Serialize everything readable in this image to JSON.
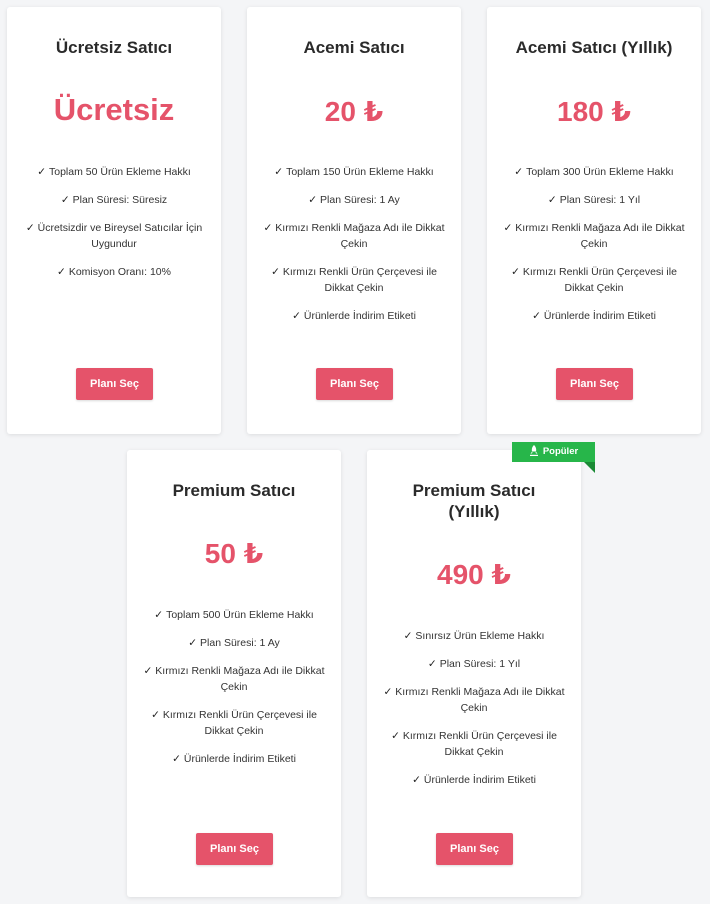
{
  "theme": {
    "accent": "#e5536a",
    "badge_color": "#27b64a",
    "background": "#f4f5f7"
  },
  "plans": [
    {
      "title": "Ücretsiz Satıcı",
      "price": "Ücretsiz",
      "features": [
        "Toplam 50 Ürün Ekleme Hakkı",
        "Plan Süresi: Süresiz",
        "Ücretsizdir ve Bireysel Satıcılar İçin Uygundur",
        "Komisyon Oranı: 10%"
      ],
      "button": "Planı Seç"
    },
    {
      "title": "Acemi Satıcı",
      "price": "20 ₺",
      "features": [
        "Toplam 150 Ürün Ekleme Hakkı",
        "Plan Süresi: 1 Ay",
        "Kırmızı Renkli Mağaza Adı ile Dikkat Çekin",
        "Kırmızı Renkli Ürün Çerçevesi ile Dikkat Çekin",
        "Ürünlerde İndirim Etiketi"
      ],
      "button": "Planı Seç"
    },
    {
      "title": "Acemi Satıcı (Yıllık)",
      "price": "180 ₺",
      "features": [
        "Toplam 300 Ürün Ekleme Hakkı",
        "Plan Süresi: 1 Yıl",
        "Kırmızı Renkli Mağaza Adı ile Dikkat Çekin",
        "Kırmızı Renkli Ürün Çerçevesi ile Dikkat Çekin",
        "Ürünlerde İndirim Etiketi"
      ],
      "button": "Planı Seç"
    },
    {
      "title": "Premium Satıcı",
      "price": "50 ₺",
      "features": [
        "Toplam 500 Ürün Ekleme Hakkı",
        "Plan Süresi: 1 Ay",
        "Kırmızı Renkli Mağaza Adı ile Dikkat Çekin",
        "Kırmızı Renkli Ürün Çerçevesi ile Dikkat Çekin",
        "Ürünlerde İndirim Etiketi"
      ],
      "button": "Planı Seç"
    },
    {
      "title": "Premium Satıcı (Yıllık)",
      "price": "490 ₺",
      "badge": "Popüler",
      "features": [
        "Sınırsız Ürün Ekleme Hakkı",
        "Plan Süresi: 1 Yıl",
        "Kırmızı Renkli Mağaza Adı ile Dikkat Çekin",
        "Kırmızı Renkli Ürün Çerçevesi ile Dikkat Çekin",
        "Ürünlerde İndirim Etiketi"
      ],
      "button": "Planı Seç"
    }
  ]
}
